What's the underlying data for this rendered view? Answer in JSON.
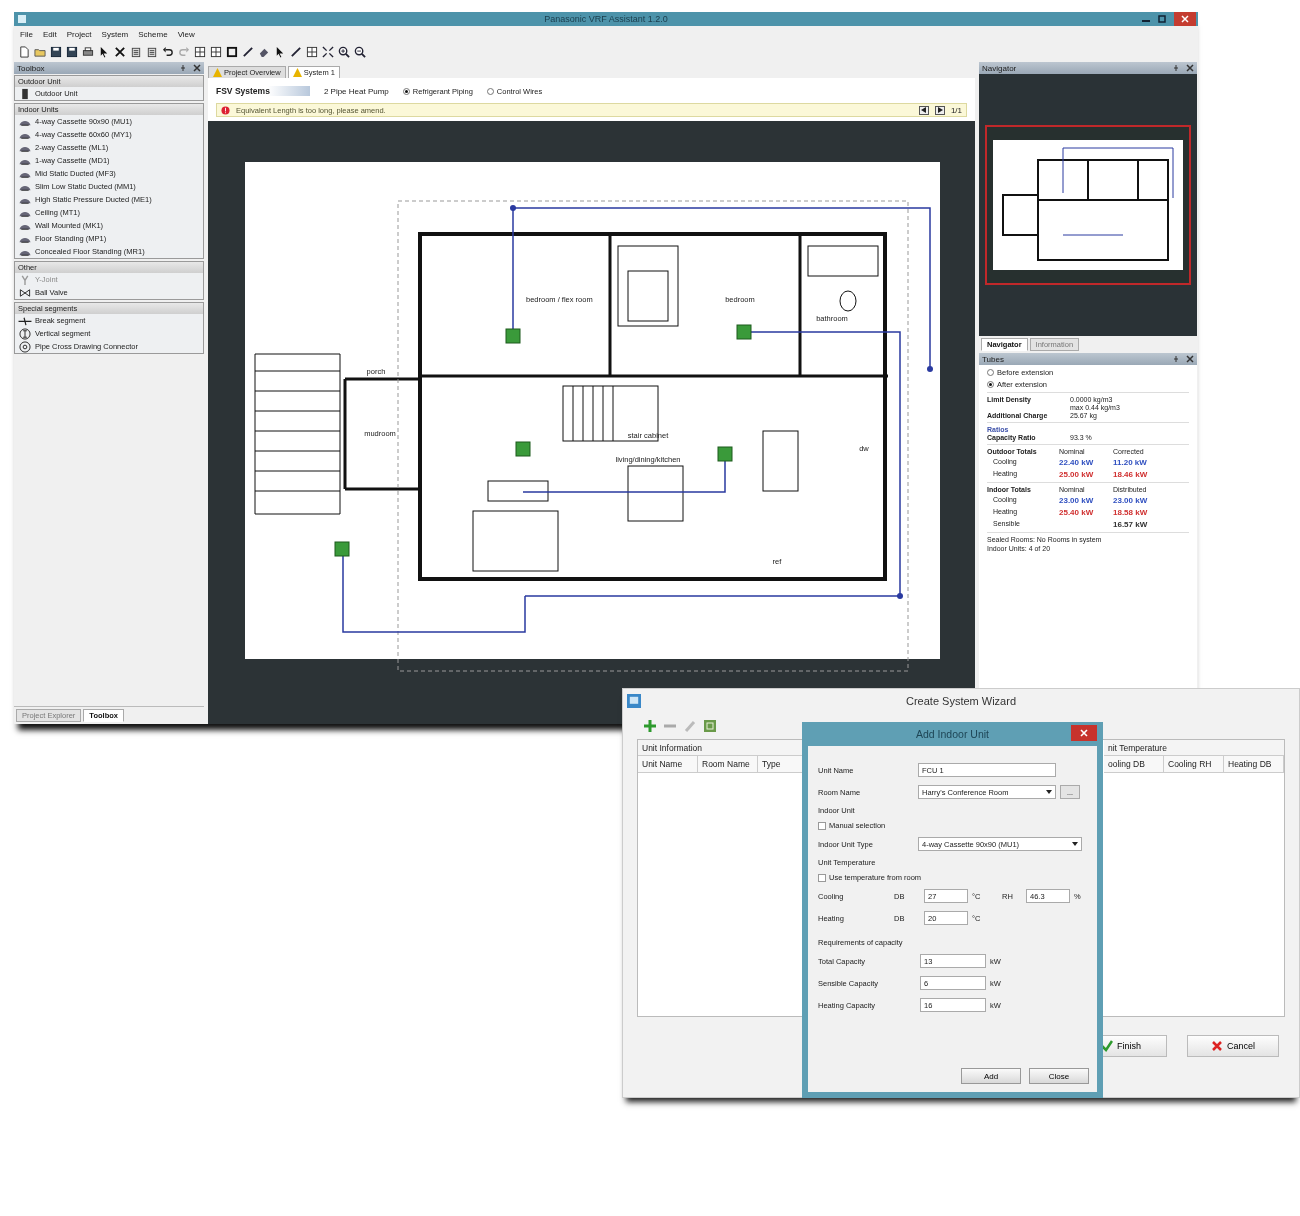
{
  "main_window": {
    "title": "Panasonic VRF Assistant 1.2.0",
    "menu": [
      "File",
      "Edit",
      "Project",
      "System",
      "Scheme",
      "View"
    ],
    "toolbox": {
      "title": "Toolbox",
      "sections": [
        {
          "title": "Outdoor Unit",
          "items": [
            {
              "label": "Outdoor Unit",
              "disabled": false
            }
          ]
        },
        {
          "title": "Indoor Units",
          "items": [
            {
              "label": "4-way Cassette 90x90 (MU1)",
              "disabled": false
            },
            {
              "label": "4-way Cassette 60x60 (MY1)",
              "disabled": false
            },
            {
              "label": "2-way Cassette (ML1)",
              "disabled": false
            },
            {
              "label": "1-way Cassette (MD1)",
              "disabled": false
            },
            {
              "label": "Mid Static Ducted (MF3)",
              "disabled": false
            },
            {
              "label": "Slim Low Static Ducted (MM1)",
              "disabled": false
            },
            {
              "label": "High Static Pressure Ducted (ME1)",
              "disabled": false
            },
            {
              "label": "Ceiling (MT1)",
              "disabled": false
            },
            {
              "label": "Wall Mounted (MK1)",
              "disabled": false
            },
            {
              "label": "Floor Standing (MP1)",
              "disabled": false
            },
            {
              "label": "Concealed Floor Standing (MR1)",
              "disabled": false
            }
          ]
        },
        {
          "title": "Other",
          "items": [
            {
              "label": "Y-Joint",
              "disabled": true
            },
            {
              "label": "Ball Valve",
              "disabled": false
            }
          ]
        },
        {
          "title": "Special segments",
          "items": [
            {
              "label": "Break segment",
              "disabled": false
            },
            {
              "label": "Vertical segment",
              "disabled": false
            },
            {
              "label": "Pipe Cross Drawing Connector",
              "disabled": false
            }
          ]
        }
      ]
    },
    "bottom_tabs": [
      {
        "label": "Project Explorer",
        "selected": false
      },
      {
        "label": "Toolbox",
        "selected": true
      }
    ],
    "document_tabs": [
      {
        "label": "Project Overview",
        "selected": false
      },
      {
        "label": "System 1",
        "selected": true
      }
    ],
    "system_bar": {
      "name": "FSV Systems",
      "type": "2 Pipe Heat Pump",
      "modes": [
        {
          "label": "Refrigerant Piping",
          "selected": true
        },
        {
          "label": "Control Wires",
          "selected": false
        }
      ]
    },
    "warning": {
      "message": "Equivalent Length is too long, please amend.",
      "counter": "1/1"
    },
    "floor_plan": {
      "rooms": [
        "bedroom / flex room",
        "bedroom",
        "bathroom",
        "porch",
        "mudroom",
        "stair cabinet",
        "living/dining/kitchen",
        "ref",
        "dw"
      ]
    },
    "navigator": {
      "title": "Navigator",
      "tabs": [
        {
          "label": "Navigator",
          "selected": true
        },
        {
          "label": "Information",
          "selected": false
        }
      ]
    },
    "tubes": {
      "title": "Tubes",
      "options": [
        {
          "label": "Before extension",
          "selected": false
        },
        {
          "label": "After extension",
          "selected": true
        }
      ],
      "limit_density": {
        "label": "Limit Density",
        "value": "0.0000 kg/m3",
        "max": "max 0.44 kg/m3"
      },
      "additional_charge": {
        "label": "Additional Charge",
        "value": "25.67 kg"
      },
      "ratios": {
        "title": "Ratios",
        "label": "Capacity Ratio",
        "value": "93.3 %"
      },
      "outdoor_totals": {
        "label": "Outdoor Totals",
        "columns": [
          "Nominal",
          "Corrected"
        ],
        "rows": [
          {
            "label": "Cooling",
            "color": "#3050c0",
            "values": [
              "22.40 kW",
              "11.20 kW"
            ]
          },
          {
            "label": "Heating",
            "color": "#d03030",
            "values": [
              "25.00 kW",
              "18.46 kW"
            ]
          }
        ]
      },
      "indoor_totals": {
        "label": "Indoor Totals",
        "columns": [
          "Nominal",
          "Distributed"
        ],
        "rows": [
          {
            "label": "Cooling",
            "color": "#3050c0",
            "values": [
              "23.00 kW",
              "23.00 kW"
            ]
          },
          {
            "label": "Heating",
            "color": "#d03030",
            "values": [
              "25.40 kW",
              "18.58 kW"
            ]
          },
          {
            "label": "Sensible",
            "color": "#333333",
            "values": [
              "16.57 kW"
            ]
          }
        ]
      },
      "footer": [
        "Sealed Rooms: No Rooms in system",
        "Indoor Units: 4 of 20"
      ]
    }
  },
  "wizard": {
    "title": "Create System Wizard",
    "groups": [
      "Unit Information",
      "nit Temperature"
    ],
    "left_columns": [
      "Unit Name",
      "Room Name",
      "Type"
    ],
    "right_columns": [
      "ooling DB",
      "Cooling RH",
      "Heating DB"
    ],
    "buttons": [
      {
        "label": "Finish",
        "kind": "finish"
      },
      {
        "label": "Cancel",
        "kind": "cancel"
      }
    ]
  },
  "dialog": {
    "title": "Add Indoor Unit",
    "unit_name": {
      "label": "Unit Name",
      "value": "FCU 1"
    },
    "room_name": {
      "label": "Room Name",
      "value": "Harry's Conference Room",
      "browse": "..."
    },
    "indoor_unit": {
      "title": "Indoor Unit",
      "manual": {
        "label": "Manual selection",
        "checked": false
      },
      "type_label": "Indoor Unit Type",
      "type_value": "4-way Cassette 90x90 (MU1)"
    },
    "temperature": {
      "title": "Unit Temperature",
      "use_room": {
        "label": "Use temperature from room",
        "checked": false
      },
      "cooling": {
        "label": "Cooling",
        "db_label": "DB",
        "db": "27",
        "unit": "°C",
        "rh_label": "RH",
        "rh": "46.3",
        "rh_unit": "%"
      },
      "heating": {
        "label": "Heating",
        "db_label": "DB",
        "db": "20",
        "unit": "°C"
      }
    },
    "capacity": {
      "title": "Requirements of capacity",
      "rows": [
        {
          "label": "Total Capacity",
          "value": "13",
          "unit": "kW"
        },
        {
          "label": "Sensible Capacity",
          "value": "6",
          "unit": "kW"
        },
        {
          "label": "Heating Capacity",
          "value": "16",
          "unit": "kW"
        }
      ]
    },
    "buttons": [
      "Add",
      "Close"
    ]
  }
}
